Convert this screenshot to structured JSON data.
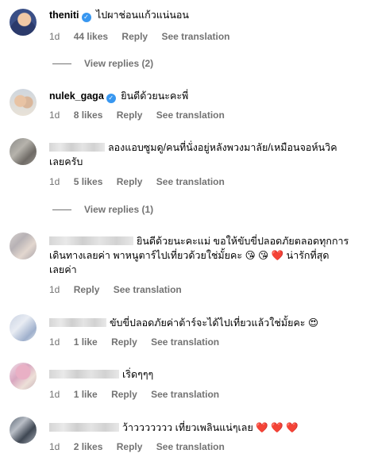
{
  "comments": [
    {
      "username": "theniti",
      "verified": true,
      "text": "ไปผาช่อนแก้วแน่นอน",
      "time": "1d",
      "likes": "44 likes",
      "reply": "Reply",
      "see_translation": "See translation",
      "view_replies": "View replies (2)"
    },
    {
      "username": "nulek_gaga",
      "verified": true,
      "text": "ยินดีด้วยนะคะพี่",
      "time": "1d",
      "likes": "8 likes",
      "reply": "Reply",
      "see_translation": "See translation"
    },
    {
      "text_line1": "ลองแอบซูมดู/คนที่นั่งอยู่หลังพวงมาลัย/เหมือนจอห์นวิค",
      "text_line2": "เลยครับ",
      "time": "1d",
      "likes": "5 likes",
      "reply": "Reply",
      "see_translation": "See translation",
      "view_replies": "View replies (1)"
    },
    {
      "text_line1": "ยินดีด้วยนะคะแม่ ขอให้ขับขี่ปลอดภัยตลอดทุกการ",
      "text_line2": "เดินทางเลยค่า พาหนูตาร์ไปเที่ยวด้วยใช่มั้ยคะ",
      "text_line2_tail": "น่ารักที่สุด",
      "text_line3": "เลยค่า",
      "emoji_a": "😘",
      "emoji_b": "😘",
      "emoji_c": "❤️",
      "time": "1d",
      "reply": "Reply",
      "see_translation": "See translation"
    },
    {
      "text": "ขับขี่ปลอดภัยค่าต้าร์จะได้ไปเที่ยวแล้วใช่มั้ยคะ",
      "emoji": "😍",
      "time": "1d",
      "likes": "1 like",
      "reply": "Reply",
      "see_translation": "See translation"
    },
    {
      "text": "เริ่ดๆๆๆ",
      "time": "1d",
      "likes": "1 like",
      "reply": "Reply",
      "see_translation": "See translation"
    },
    {
      "text": "ว้าววววววว เที่ยวเพลินแน่ๆเลย",
      "emoji": "❤️ ❤️ ❤️",
      "time": "1d",
      "likes": "2 likes",
      "reply": "Reply",
      "see_translation": "See translation"
    }
  ]
}
